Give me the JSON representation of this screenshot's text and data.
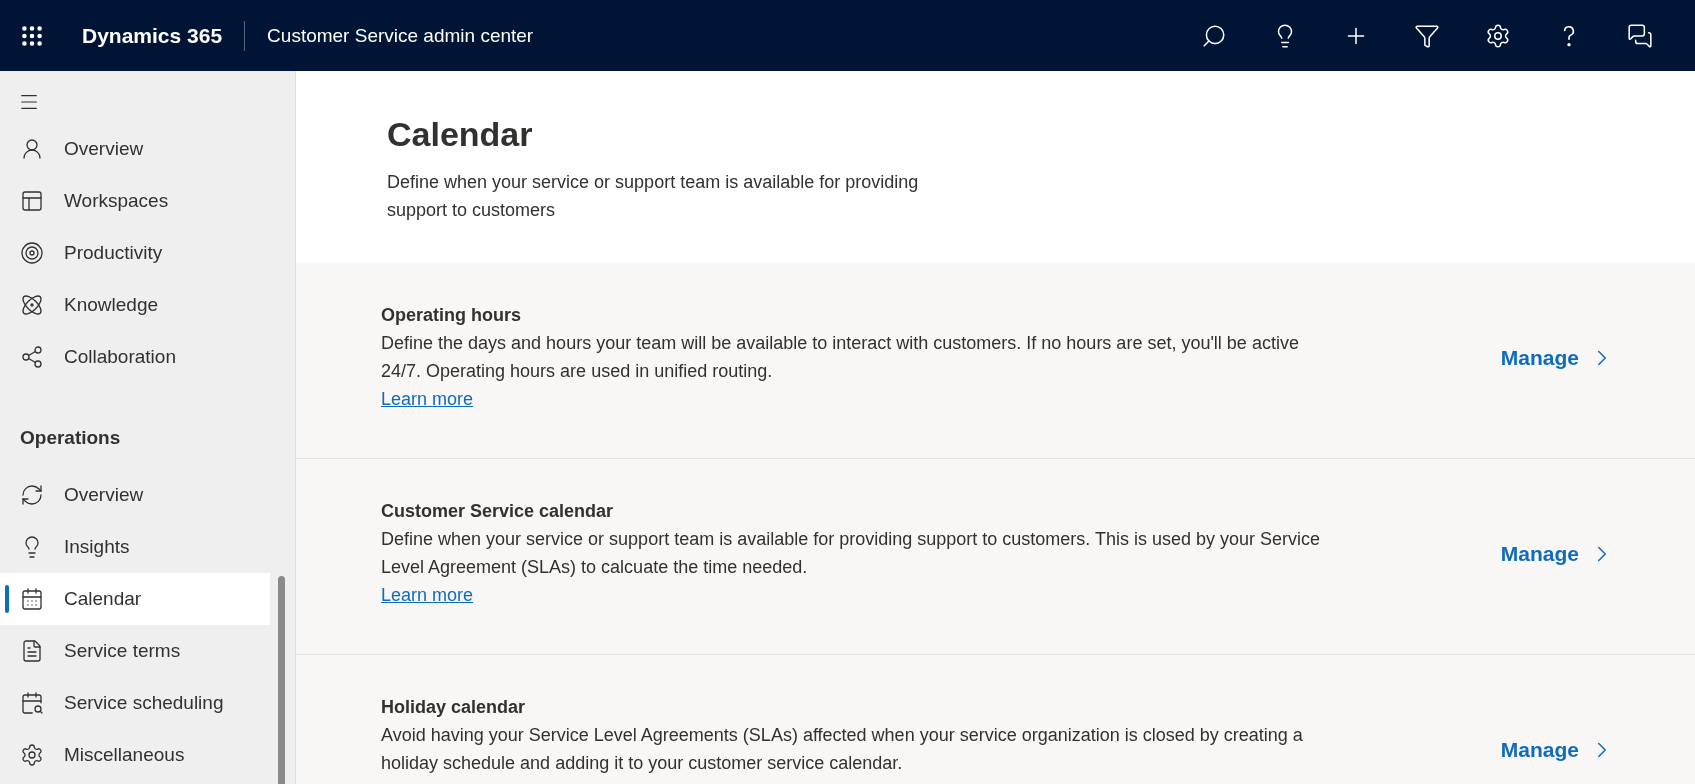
{
  "header": {
    "brand": "Dynamics 365",
    "app_title": "Customer Service admin center",
    "actions": [
      {
        "kind": "search"
      },
      {
        "kind": "lightbulb"
      },
      {
        "kind": "plus"
      },
      {
        "kind": "filter"
      },
      {
        "kind": "settings"
      },
      {
        "kind": "help"
      },
      {
        "kind": "chat"
      }
    ]
  },
  "sidebar": {
    "groups": [
      {
        "items": [
          {
            "label": "Overview",
            "selected": false
          },
          {
            "label": "Workspaces",
            "selected": false
          },
          {
            "label": "Productivity",
            "selected": false
          },
          {
            "label": "Knowledge",
            "selected": false
          },
          {
            "label": "Collaboration",
            "selected": false
          }
        ]
      },
      {
        "title": "Operations",
        "items": [
          {
            "label": "Overview",
            "selected": false
          },
          {
            "label": "Insights",
            "selected": false
          },
          {
            "label": "Calendar",
            "selected": true
          },
          {
            "label": "Service terms",
            "selected": false
          },
          {
            "label": "Service scheduling",
            "selected": false
          },
          {
            "label": "Miscellaneous",
            "selected": false
          }
        ]
      }
    ]
  },
  "page": {
    "title": "Calendar",
    "description": "Define when your service or support team is available for providing support to customers",
    "sections": [
      {
        "title": "Operating hours",
        "description": "Define the days and hours your team will be available to interact with customers. If no hours are set, you'll be active 24/7. Operating hours are used in unified routing.",
        "link": "Learn more",
        "action": "Manage"
      },
      {
        "title": "Customer Service calendar",
        "description": "Define when your service or support team is available for providing support to customers. This is used by your Service Level Agreement (SLAs) to calcuate the time needed.",
        "link": "Learn more",
        "action": "Manage"
      },
      {
        "title": "Holiday calendar",
        "description": "Avoid having your Service Level Agreements (SLAs) affected when your service organization is closed by creating a holiday schedule and adding it to your customer service calendar.",
        "action": "Manage"
      }
    ]
  }
}
